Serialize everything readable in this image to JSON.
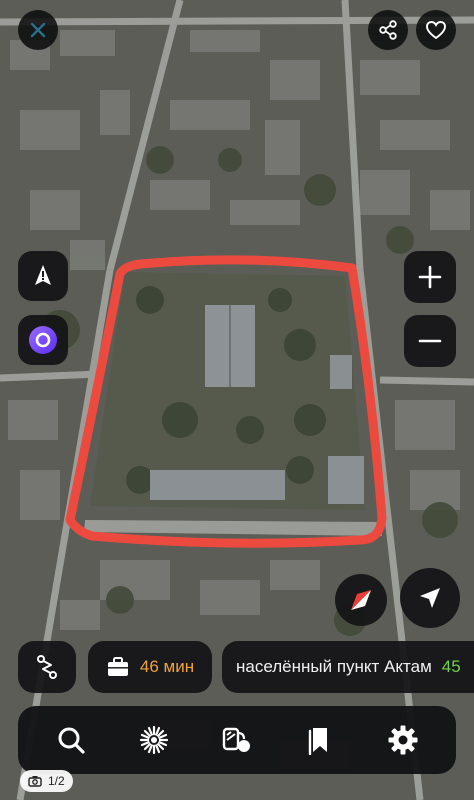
{
  "top_bar": {
    "close_icon": "close-icon",
    "share_icon": "share-icon",
    "favorite_icon": "heart-icon"
  },
  "map_controls": {
    "road_alert_icon": "road-alert-icon",
    "assistant_icon": "alice-assistant-icon",
    "zoom_in_icon": "plus-icon",
    "zoom_out_icon": "minus-icon",
    "compass_icon": "compass-icon",
    "locate_icon": "navigation-arrow-icon"
  },
  "route_panel": {
    "route_icon": "route-icon",
    "travel_time": "46 мин",
    "destination": "населённый пункт Актам",
    "distance_fragment": "45"
  },
  "bottom_tabs": [
    {
      "name": "search",
      "icon": "search-icon"
    },
    {
      "name": "discovery",
      "icon": "sparkle-icon"
    },
    {
      "name": "transport",
      "icon": "transport-icon"
    },
    {
      "name": "bookmarks",
      "icon": "bookmark-icon"
    },
    {
      "name": "settings",
      "icon": "gear-icon"
    }
  ],
  "photo_counter": "1/2",
  "colors": {
    "annotation": "#ec4a3f",
    "eta": "#f0a33a",
    "distance": "#6fd24a",
    "panel": "#141416"
  }
}
